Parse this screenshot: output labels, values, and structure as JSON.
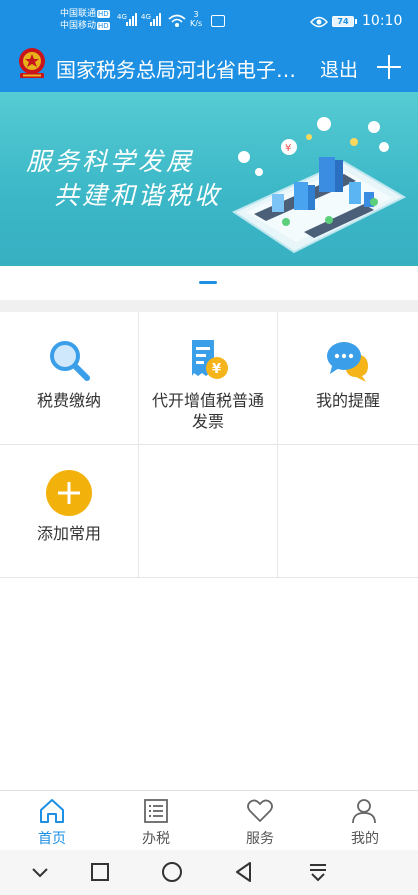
{
  "status_bar": {
    "carrier1": "中国联通",
    "carrier2": "中国移动",
    "hd": "HD",
    "net1": "4G",
    "net2": "4G",
    "speed_value": "3",
    "speed_unit": "K/s",
    "battery": "74",
    "time": "10:10"
  },
  "header": {
    "title": "国家税务总局河北省电子税务局",
    "logout_label": "退出"
  },
  "banner": {
    "line1": "服务科学发展",
    "line2": "共建和谐税收"
  },
  "menu": [
    {
      "label": "税费缴纳",
      "icon": "search-icon"
    },
    {
      "label": "代开增值税普通发票",
      "icon": "invoice-icon"
    },
    {
      "label": "我的提醒",
      "icon": "chat-bubble-icon"
    },
    {
      "label": "添加常用",
      "icon": "add-circle-icon"
    }
  ],
  "bottom_nav": [
    {
      "label": "首页",
      "icon": "home-icon",
      "active": true
    },
    {
      "label": "办税",
      "icon": "list-icon",
      "active": false
    },
    {
      "label": "服务",
      "icon": "heart-icon",
      "active": false
    },
    {
      "label": "我的",
      "icon": "user-icon",
      "active": false
    }
  ],
  "colors": {
    "primary": "#1d90e3",
    "banner": "#3bb7c7",
    "add_button": "#f2b10b"
  }
}
